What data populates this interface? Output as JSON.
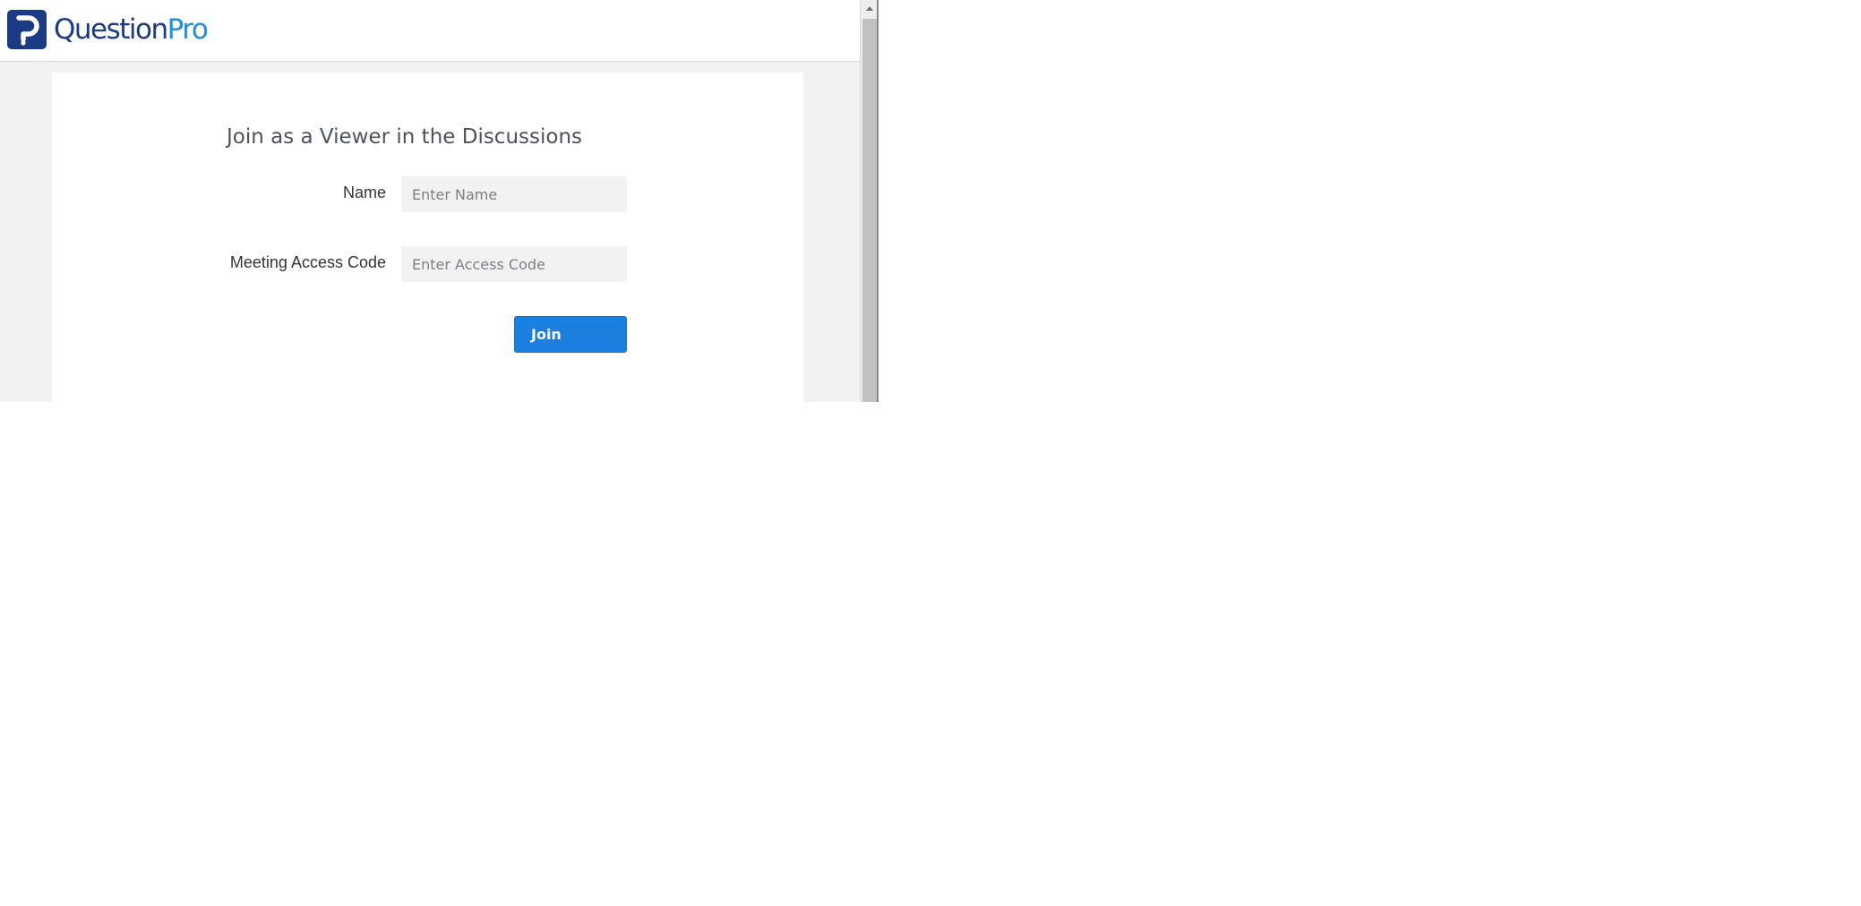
{
  "brand": {
    "name_part1": "Question",
    "name_part2": "Pro",
    "primary_color": "#1b3b84",
    "accent_color": "#1e8ee6",
    "logo_icon": "questionpro-logo-icon"
  },
  "form": {
    "title": "Join as a Viewer in the Discussions",
    "name_label": "Name",
    "name_placeholder": "Enter Name",
    "name_value": "",
    "code_label": "Meeting Access Code",
    "code_placeholder": "Enter Access Code",
    "code_value": "",
    "join_label": "Join",
    "button_color": "#1b7fe0"
  },
  "scrollbar": {
    "up_icon": "scroll-up-arrow-icon"
  }
}
